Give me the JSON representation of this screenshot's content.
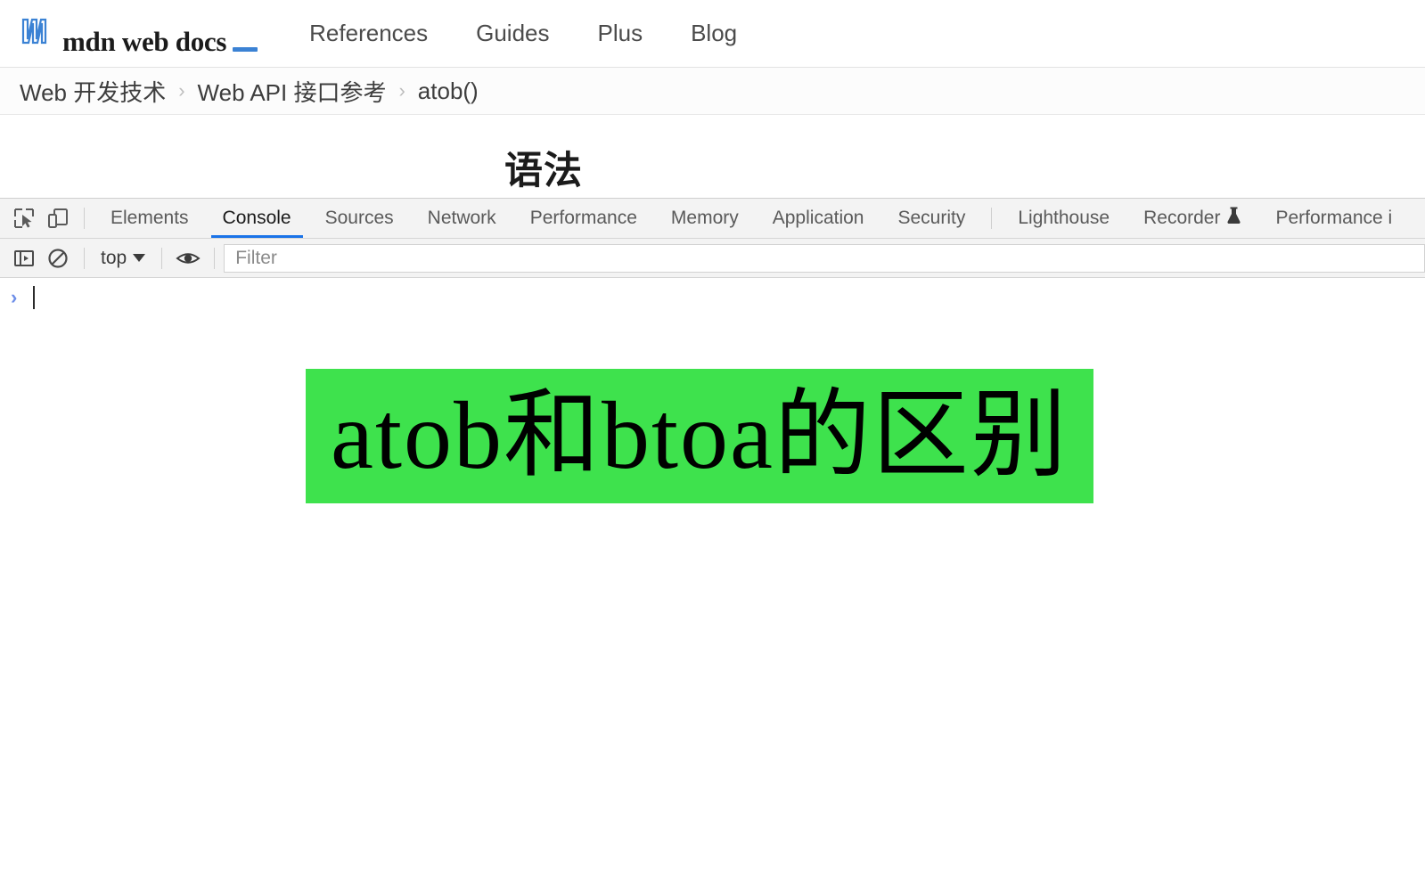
{
  "header": {
    "logo_text": "mdn web docs",
    "logo_mark": "mdn-m-icon",
    "nav": [
      {
        "label": "References"
      },
      {
        "label": "Guides"
      },
      {
        "label": "Plus"
      },
      {
        "label": "Blog"
      }
    ]
  },
  "breadcrumb": {
    "separator": "›",
    "items": [
      {
        "label": "Web 开发技术"
      },
      {
        "label": "Web API 接口参考"
      },
      {
        "label": "atob()"
      }
    ]
  },
  "document": {
    "heading": "语法"
  },
  "devtools": {
    "left_icons": [
      {
        "name": "inspect-element-icon"
      },
      {
        "name": "device-toolbar-icon"
      }
    ],
    "tabs": [
      {
        "label": "Elements",
        "active": false
      },
      {
        "label": "Console",
        "active": true
      },
      {
        "label": "Sources",
        "active": false
      },
      {
        "label": "Network",
        "active": false
      },
      {
        "label": "Performance",
        "active": false
      },
      {
        "label": "Memory",
        "active": false
      },
      {
        "label": "Application",
        "active": false
      },
      {
        "label": "Security",
        "active": false
      },
      {
        "label": "Lighthouse",
        "active": false
      },
      {
        "label": "Recorder",
        "active": false,
        "badge": "flask-icon"
      },
      {
        "label": "Performance i",
        "active": false
      }
    ],
    "console_toolbar": {
      "sidebar_toggle": "console-sidebar-icon",
      "clear_console": "clear-console-icon",
      "context_label": "top",
      "eye_icon": "live-expression-eye-icon",
      "filter_placeholder": "Filter"
    },
    "console_prompt": {
      "arrow": "›",
      "value": ""
    },
    "active_tab_color": "#1a73e8"
  },
  "banner": {
    "text": "atob和btoa的区别",
    "background_color": "#3ee24d",
    "text_color": "#000000"
  }
}
